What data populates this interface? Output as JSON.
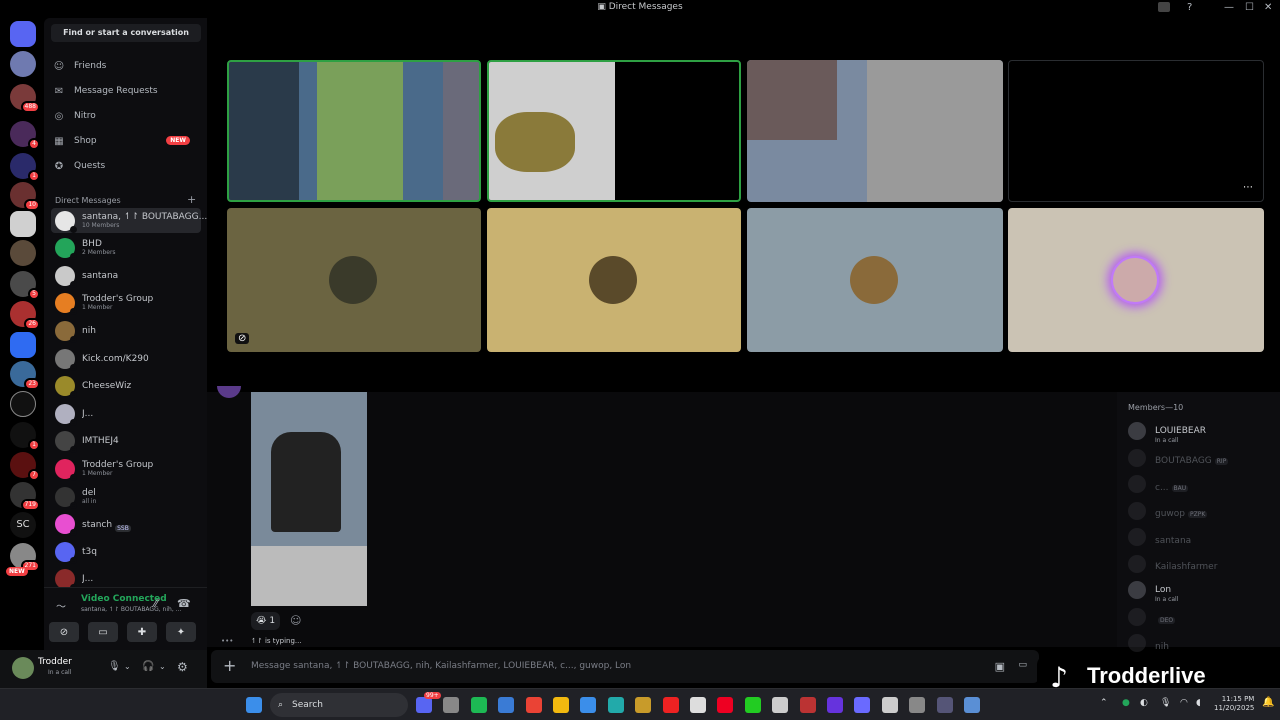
{
  "window": {
    "title": "Direct Messages",
    "minimize_icon": "—",
    "maximize_icon": "☐",
    "close_icon": "✕"
  },
  "sidebar": {
    "find_label": "Find or start a conversation",
    "nav": [
      {
        "label": "Friends",
        "icon": "people-icon"
      },
      {
        "label": "Message Requests",
        "icon": "envelope-icon"
      },
      {
        "label": "Nitro",
        "icon": "nitro-icon"
      },
      {
        "label": "Shop",
        "icon": "shop-icon",
        "badge": "NEW"
      },
      {
        "label": "Quests",
        "icon": "quests-icon"
      }
    ],
    "dm_header": "Direct Messages",
    "dms": [
      {
        "name": "santana, ↿↾ BOUTABAGG...",
        "sub": "10 Members",
        "color": "#e6e6e6",
        "selected": true
      },
      {
        "name": "BHD",
        "sub": "2 Members",
        "color": "#23a55a"
      },
      {
        "name": "santana",
        "sub": "",
        "color": "#c9c9c9"
      },
      {
        "name": "Trodder's Group",
        "sub": "1 Member",
        "color": "#e67e22"
      },
      {
        "name": "nih",
        "sub": "",
        "color": "#8a6a3a"
      },
      {
        "name": "Kick.com/K290",
        "sub": "",
        "color": "#777"
      },
      {
        "name": "CheeseWiz",
        "sub": "",
        "color": "#9a8a2a"
      },
      {
        "name": "J...",
        "sub": "",
        "color": "#b0b0c0"
      },
      {
        "name": "IMTHEJ4",
        "sub": "",
        "color": "#444"
      },
      {
        "name": "Trodder's Group",
        "sub": "1 Member",
        "color": "#e0245e"
      },
      {
        "name": "del",
        "sub": "all in",
        "color": "#333"
      },
      {
        "name": "stanch",
        "sub": "",
        "tag": "SSB",
        "color": "#e84fd1"
      },
      {
        "name": "t3q",
        "sub": "",
        "color": "#5865f2"
      },
      {
        "name": "J...",
        "sub": "",
        "color": "#8a2a2a"
      }
    ],
    "server_badges": [
      "488",
      "4",
      "1",
      "10",
      "5",
      "26",
      "23",
      "1",
      "7",
      "719",
      "271"
    ],
    "server_new": "NEW",
    "server_text": "SC"
  },
  "voice": {
    "title": "Video Connected",
    "sub": "santana, ↿↾ BOUTABAGG, nih, ..."
  },
  "user": {
    "name": "Trodder",
    "status": "In a call"
  },
  "members": {
    "header": "Members—10",
    "list": [
      {
        "name": "LOUIEBEAR",
        "sub": "In a call",
        "dim": false
      },
      {
        "name": "BOUTABAGG",
        "tag": "RIP",
        "dim": true
      },
      {
        "name": "c...",
        "tag": "BAU",
        "dim": true
      },
      {
        "name": "guwop",
        "tag": "PZPK",
        "dim": true
      },
      {
        "name": "santana",
        "dim": true
      },
      {
        "name": "Kailashfarmer",
        "dim": true
      },
      {
        "name": "Lon",
        "sub": "In a call",
        "dim": false
      },
      {
        "name": "",
        "tag": "DEO",
        "dim": true
      },
      {
        "name": "nih",
        "dim": true
      }
    ]
  },
  "chat": {
    "reaction_count": "1",
    "reaction_emoji": "😭",
    "typing": "↿↾ is typing...",
    "placeholder": "Message santana, ↿↾ BOUTABAGG, nih, Kailashfarmer, LOUIEBEAR, c..., guwop, Lon"
  },
  "overlay": {
    "tiktok_name": "Trodderlive"
  },
  "taskbar": {
    "search": "Search",
    "time": "11:15 PM",
    "date": "11/20/2025",
    "badge": "99+"
  },
  "colors": {
    "tile_olive": "#6b6441",
    "tile_sand": "#c9b271",
    "tile_grey": "#8c9ca6",
    "tile_cream": "#cbc3b4",
    "accent": "#5865f2"
  }
}
